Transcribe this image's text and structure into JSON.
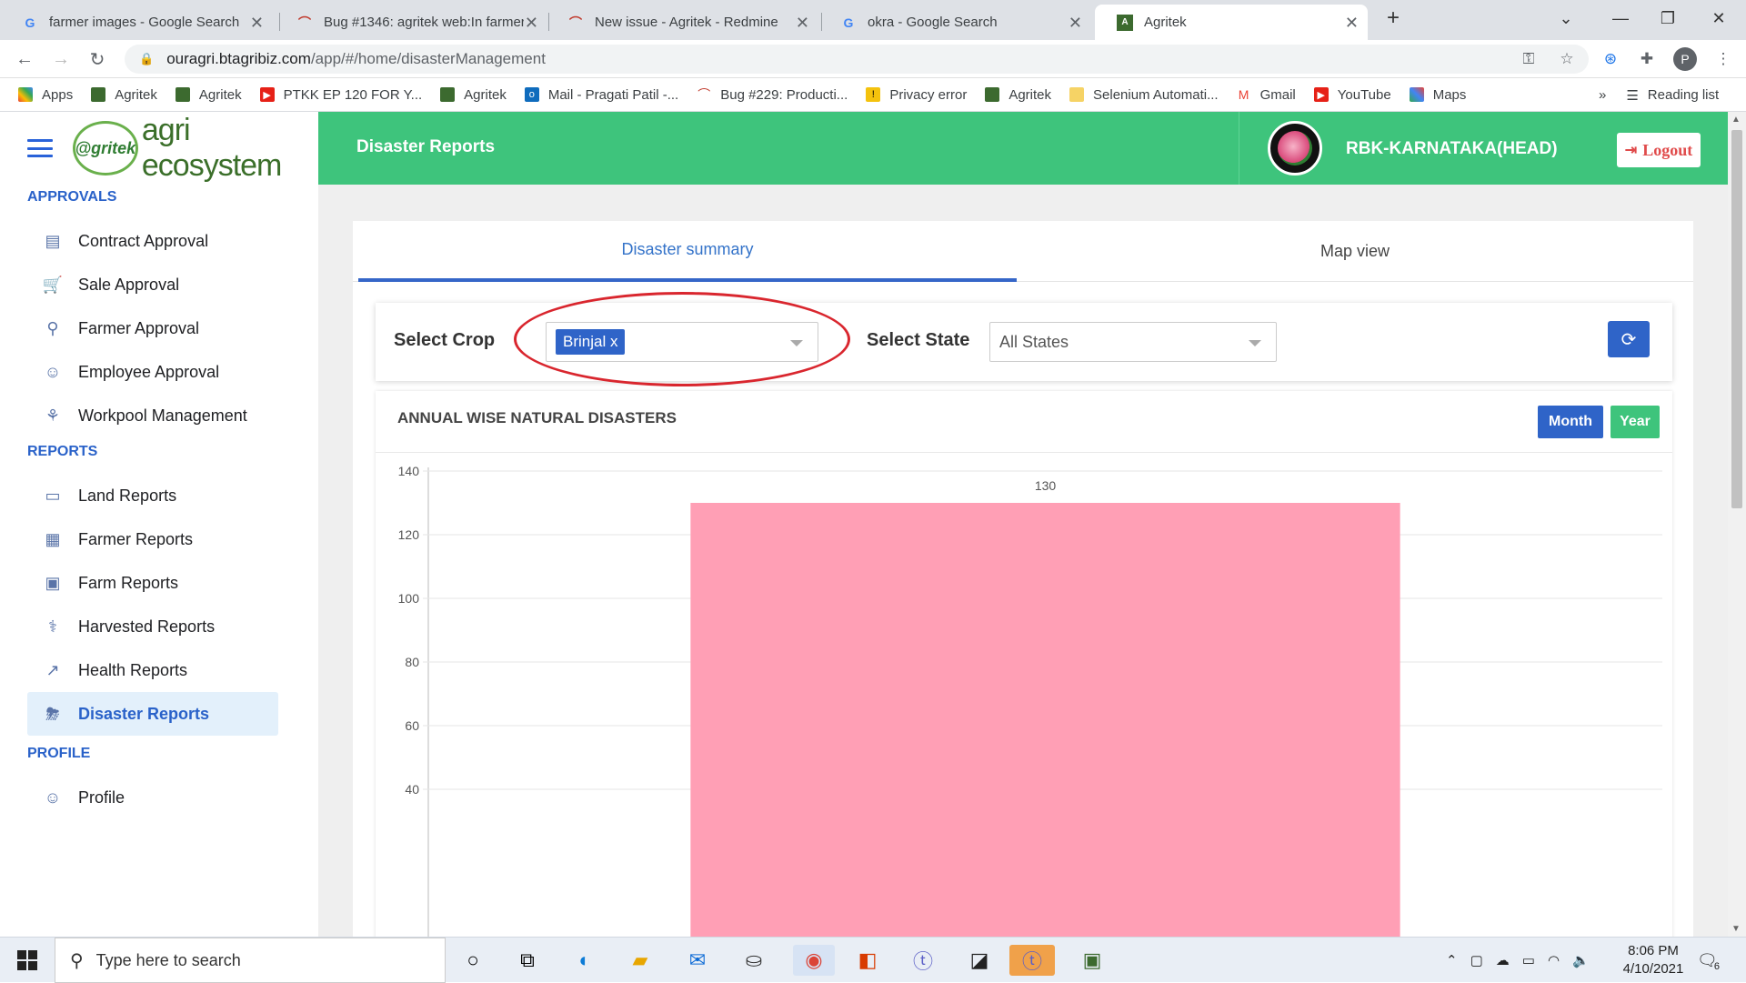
{
  "browser": {
    "tabs": [
      {
        "title": "farmer images - Google Search",
        "icon": "google-icon"
      },
      {
        "title": "Bug #1346: agritek web:In farmer",
        "icon": "redmine-icon"
      },
      {
        "title": "New issue - Agritek - Redmine",
        "icon": "redmine-icon"
      },
      {
        "title": "okra - Google Search",
        "icon": "google-icon"
      },
      {
        "title": "Agritek",
        "icon": "agritek-icon"
      }
    ],
    "url_host": "ouragri.btagribiz.com",
    "url_path": "/app/#/home/disasterManagement",
    "bookmarks": [
      "Apps",
      "Agritek",
      "Agritek",
      "PTKK EP 120 FOR Y...",
      "Agritek",
      "Mail - Pragati Patil -...",
      "Bug #229: Producti...",
      "Privacy error",
      "Agritek",
      "Selenium Automati...",
      "Gmail",
      "YouTube",
      "Maps"
    ],
    "reading_list": "Reading list",
    "profile_initial": "P"
  },
  "sidebar": {
    "logo_mark": "@gritek",
    "logo_text": "agri ecosystem",
    "sections": {
      "approvals": "APPROVALS",
      "reports": "REPORTS",
      "profile": "PROFILE"
    },
    "approvals": [
      "Contract Approval",
      "Sale Approval",
      "Farmer Approval",
      "Employee Approval",
      "Workpool Management"
    ],
    "reports": [
      "Land Reports",
      "Farmer Reports",
      "Farm Reports",
      "Harvested Reports",
      "Health Reports",
      "Disaster Reports"
    ],
    "profile": [
      "Profile"
    ]
  },
  "header": {
    "title": "Disaster Reports",
    "user": "RBK-KARNATAKA(HEAD)",
    "logout": "Logout"
  },
  "tabs": {
    "summary": "Disaster summary",
    "map": "Map view"
  },
  "filters": {
    "crop_label": "Select Crop",
    "crop_chip": "Brinjal",
    "chip_remove": "x",
    "state_label": "Select State",
    "state_value": "All States"
  },
  "chart_section": {
    "title": "ANNUAL WISE NATURAL DISASTERS",
    "month_btn": "Month",
    "year_btn": "Year"
  },
  "chart_data": {
    "type": "bar",
    "values": [
      130
    ],
    "data_labels": [
      "130"
    ],
    "yticks": [
      140,
      120,
      100,
      80,
      60,
      40
    ],
    "ylim": [
      0,
      140
    ],
    "bar_color": "#ff9fb5"
  },
  "taskbar": {
    "search_placeholder": "Type here to search",
    "time": "8:06 PM",
    "date": "4/10/2021",
    "notification_count": "6"
  }
}
